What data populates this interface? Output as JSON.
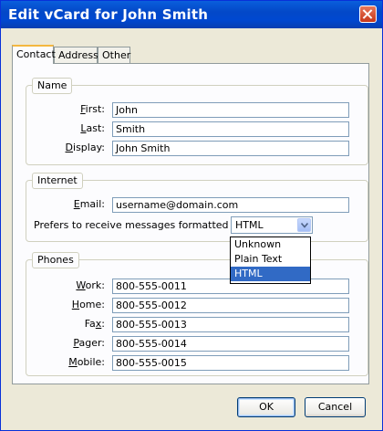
{
  "window": {
    "title": "Edit vCard for John Smith"
  },
  "tabs": [
    {
      "label": "Contact",
      "active": true
    },
    {
      "label": "Address",
      "active": false
    },
    {
      "label": "Other",
      "active": false
    }
  ],
  "name_group": {
    "legend": "Name",
    "first": {
      "label_key": "F",
      "label_rest": "irst:",
      "value": "John"
    },
    "last": {
      "label_key": "L",
      "label_rest": "ast:",
      "value": "Smith"
    },
    "display": {
      "label_key": "D",
      "label_rest": "isplay:",
      "value": "John Smith"
    }
  },
  "internet_group": {
    "legend": "Internet",
    "email": {
      "label_key": "E",
      "label_rest": "mail:",
      "value": "username@domain.com"
    },
    "format": {
      "label": "Prefers to receive messages formatted as:",
      "selected": "HTML",
      "options": [
        "Unknown",
        "Plain Text",
        "HTML"
      ],
      "highlighted_index": 2
    }
  },
  "phones_group": {
    "legend": "Phones",
    "work": {
      "label_key": "W",
      "label_rest": "ork:",
      "value": "800-555-0011"
    },
    "home": {
      "label_key": "H",
      "label_rest": "ome:",
      "value": "800-555-0012"
    },
    "fax": {
      "label_pre": "Fa",
      "label_key": "x",
      "label_rest": ":",
      "value": "800-555-0013"
    },
    "pager": {
      "label_key": "P",
      "label_rest": "ager:",
      "value": "800-555-0014"
    },
    "mobile": {
      "label_key": "M",
      "label_rest": "obile:",
      "value": "800-555-0015"
    }
  },
  "buttons": {
    "ok": "OK",
    "cancel": "Cancel"
  },
  "colors": {
    "titlebar": "#0348c8",
    "selection": "#316ac5",
    "dialog_bg": "#ece9d8"
  }
}
